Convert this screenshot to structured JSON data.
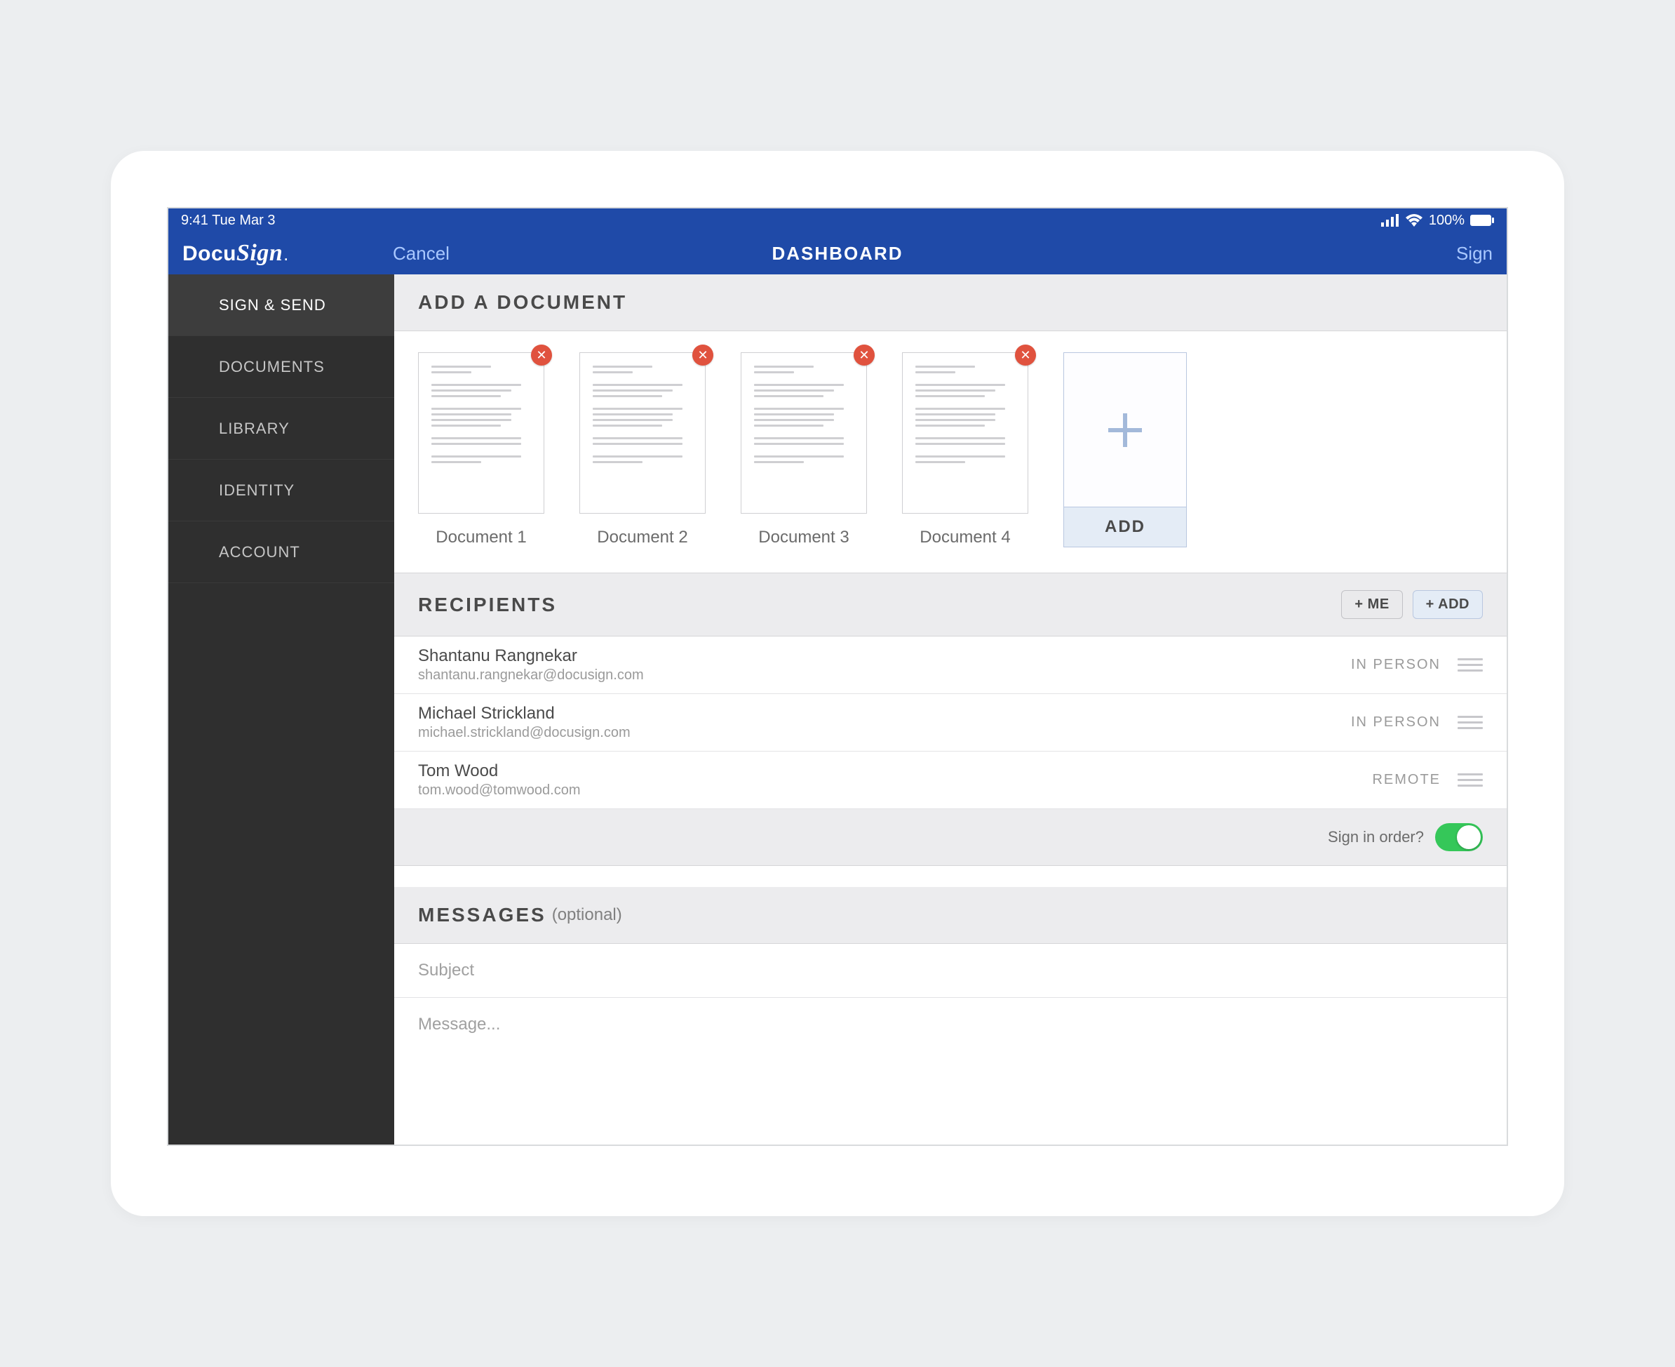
{
  "statusbar": {
    "time": "9:41 Tue Mar 3",
    "battery_pct": "100%"
  },
  "header": {
    "logo_part1": "Docu",
    "logo_part2": "Sign",
    "logo_dot": ".",
    "cancel": "Cancel",
    "title": "DASHBOARD",
    "sign": "Sign"
  },
  "sidebar": {
    "items": [
      {
        "label": "SIGN & SEND",
        "active": true
      },
      {
        "label": "DOCUMENTS",
        "active": false
      },
      {
        "label": "LIBRARY",
        "active": false
      },
      {
        "label": "IDENTITY",
        "active": false
      },
      {
        "label": "ACCOUNT",
        "active": false
      }
    ]
  },
  "sections": {
    "add_doc_title": "ADD A DOCUMENT",
    "recipients_title": "RECIPIENTS",
    "messages_title": "MESSAGES",
    "messages_optional": "(optional)"
  },
  "documents": [
    {
      "label": "Document 1"
    },
    {
      "label": "Document 2"
    },
    {
      "label": "Document 3"
    },
    {
      "label": "Document 4"
    }
  ],
  "add_tile_label": "ADD",
  "recipient_buttons": {
    "me": "+ ME",
    "add": "+ ADD"
  },
  "recipients": [
    {
      "name": "Shantanu Rangnekar",
      "email": "shantanu.rangnekar@docusign.com",
      "mode": "IN PERSON"
    },
    {
      "name": "Michael Strickland",
      "email": "michael.strickland@docusign.com",
      "mode": "IN PERSON"
    },
    {
      "name": "Tom Wood",
      "email": "tom.wood@tomwood.com",
      "mode": "REMOTE"
    }
  ],
  "sign_in_order": {
    "label": "Sign in order?",
    "value": true
  },
  "messages": {
    "subject_placeholder": "Subject",
    "body_placeholder": "Message..."
  }
}
